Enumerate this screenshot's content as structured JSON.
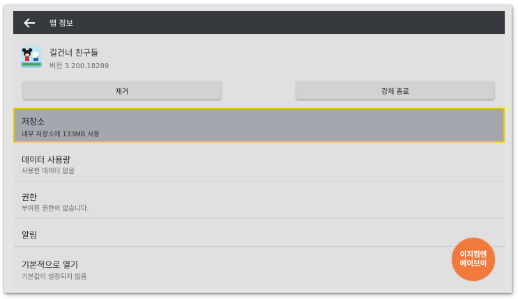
{
  "action_bar": {
    "title": "앱 정보",
    "back_icon": "arrow-left-icon",
    "color": "#363a3e"
  },
  "app": {
    "name": "길건너 친구들",
    "version": "버전 3.200.18289",
    "icon": "app-icon"
  },
  "buttons": {
    "uninstall": "제거",
    "force_stop": "강제 종료"
  },
  "settings": {
    "storage": {
      "title": "저장소",
      "subtitle": "내부 저장소에 133MB 사용"
    },
    "data_usage": {
      "title": "데이터 사용량",
      "subtitle": "사용한 데이터 없음"
    },
    "permissions": {
      "title": "권한",
      "subtitle": "부여된 권한이 없습니다."
    },
    "notifications": {
      "title": "알림"
    },
    "open_by_default": {
      "title": "기본적으로 열기",
      "subtitle": "기본값이 설정되지 않음"
    }
  },
  "highlight_color": "#f0c800",
  "watermark": {
    "line1": "이지컴앤",
    "line2": "에이브이",
    "color": "#f07a3e"
  }
}
